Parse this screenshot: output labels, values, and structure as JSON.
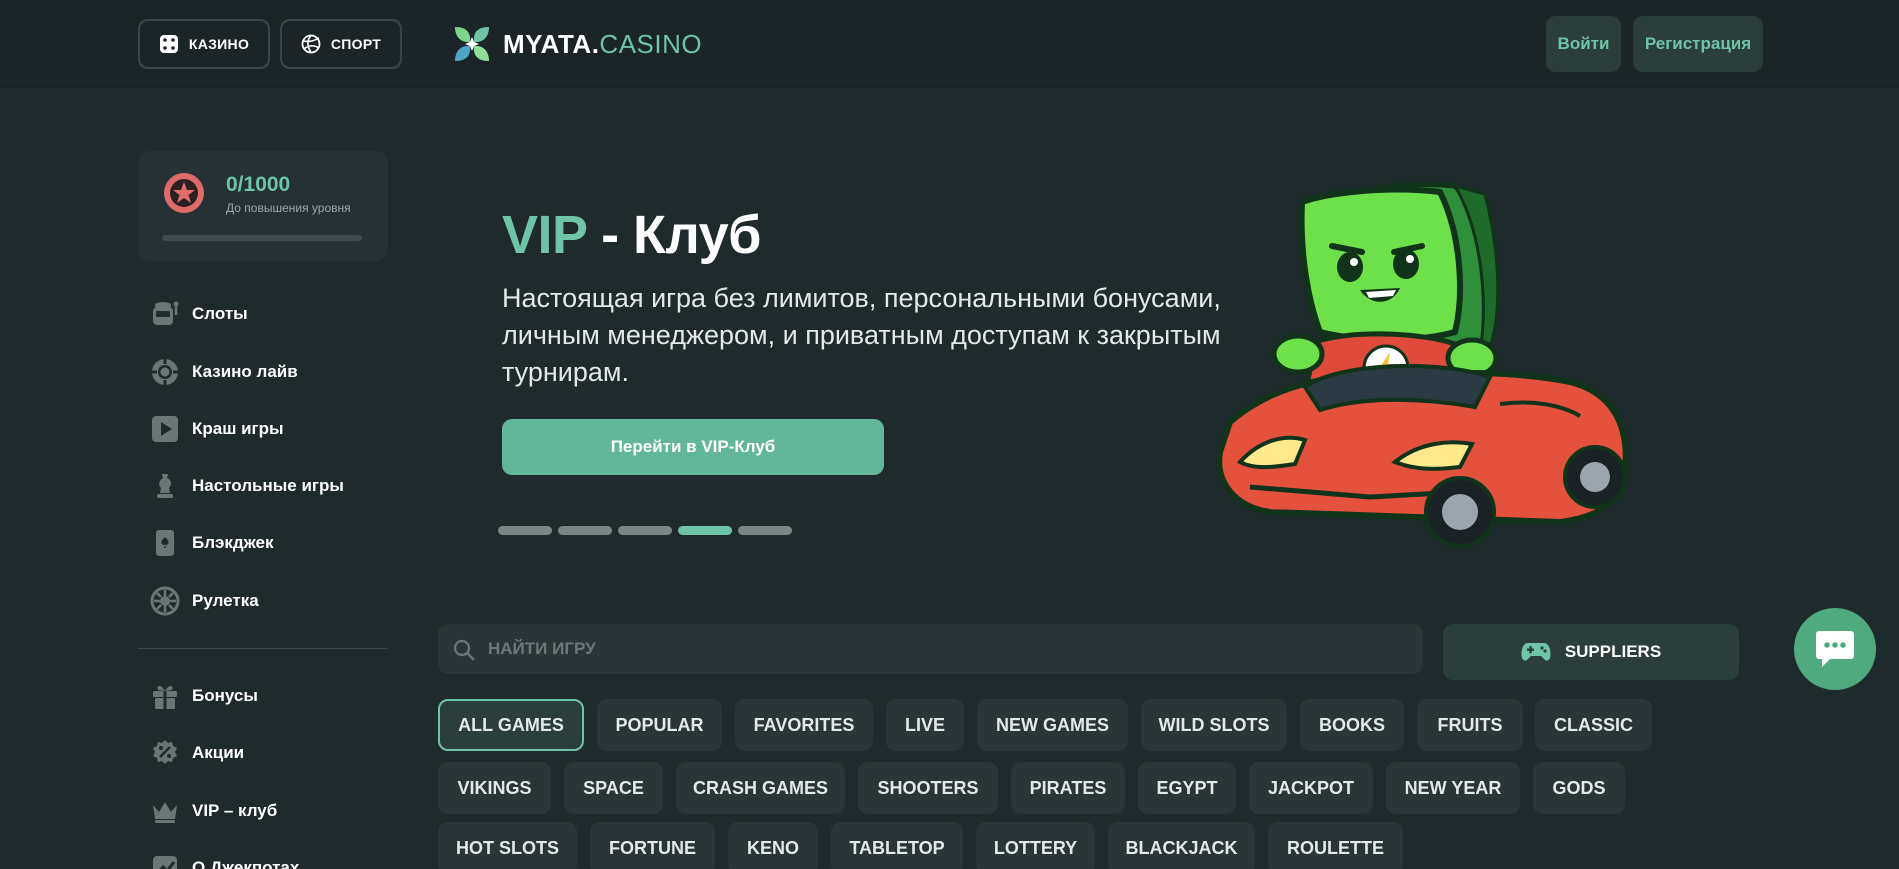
{
  "header": {
    "casino_label": "КАЗИНО",
    "sport_label": "СПОРТ",
    "logo_bold": "MYATA.",
    "logo_light": "CASINO",
    "login_label": "Войти",
    "register_label": "Регистрация"
  },
  "sidebar": {
    "level": {
      "value": "0/1000",
      "subtitle": "До повышения уровня",
      "progress": 0
    },
    "items": [
      {
        "label": "Слоты",
        "icon": "slot-machine-icon"
      },
      {
        "label": "Казино лайв",
        "icon": "casino-chip-icon"
      },
      {
        "label": "Краш игры",
        "icon": "play-icon"
      },
      {
        "label": "Настольные игры",
        "icon": "chess-icon"
      },
      {
        "label": "Блэкджек",
        "icon": "card-icon"
      },
      {
        "label": "Рулетка",
        "icon": "roulette-icon"
      },
      {
        "label": "Бонусы",
        "icon": "gift-icon"
      },
      {
        "label": "Акции",
        "icon": "discount-icon"
      },
      {
        "label": "VIP – клуб",
        "icon": "crown-icon"
      },
      {
        "label": "О Джекпотах",
        "icon": "chart-icon"
      }
    ]
  },
  "hero": {
    "title_vip": "VIP",
    "title_rest": " - Клуб",
    "text": "Настоящая игра без лимитов, персональными бонусами, личным менеджером, и приватным доступам к закрытым турнирам.",
    "cta_label": "Перейти в VIP-Клуб",
    "active_slide": 4,
    "slide_count": 5
  },
  "search": {
    "placeholder": "НАЙТИ ИГРУ"
  },
  "suppliers_label": "SUPPLIERS",
  "categories": {
    "row1": [
      "ALL GAMES",
      "POPULAR",
      "FAVORITES",
      "LIVE",
      "NEW GAMES",
      "WILD SLOTS",
      "BOOKS",
      "FRUITS",
      "CLASSIC"
    ],
    "row2": [
      "VIKINGS",
      "SPACE",
      "CRASH GAMES",
      "SHOOTERS",
      "PIRATES",
      "EGYPT",
      "JACKPOT",
      "NEW YEAR",
      "GODS"
    ],
    "row3": [
      "HOT SLOTS",
      "FORTUNE",
      "KENO",
      "TABLETOP",
      "LOTTERY",
      "BLACKJACK",
      "ROULETTE"
    ]
  },
  "colors": {
    "accent": "#6fc3a6",
    "background": "#1f2a2c",
    "header": "#1b2527",
    "chat": "#4fab7f"
  }
}
